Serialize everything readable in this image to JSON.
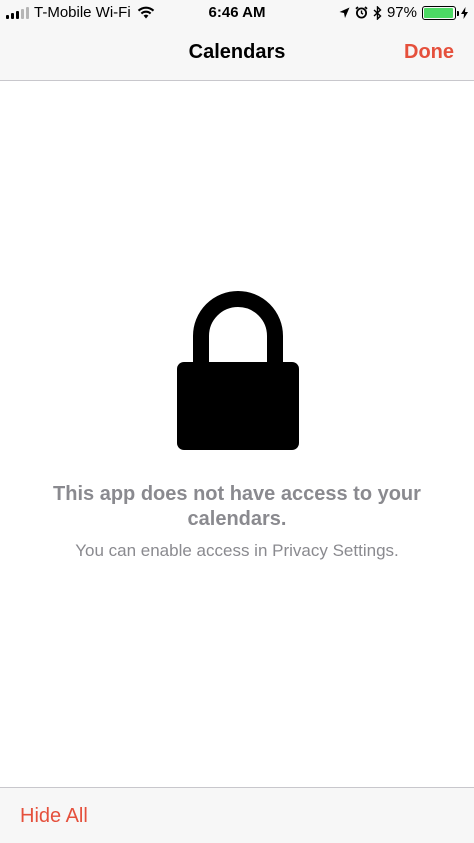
{
  "status_bar": {
    "carrier": "T-Mobile Wi-Fi",
    "time": "6:46 AM",
    "battery_percent": "97%",
    "battery_level": 0.97,
    "icons": [
      "signal-bars-icon",
      "wifi-icon",
      "location-arrow-icon",
      "alarm-clock-icon",
      "bluetooth-icon",
      "battery-icon",
      "charging-bolt-icon"
    ]
  },
  "nav": {
    "title": "Calendars",
    "done_label": "Done"
  },
  "content": {
    "icon": "lock-icon",
    "message_title": "This app does not have access to your calendars.",
    "message_subtitle": "You can enable access in Privacy Settings."
  },
  "toolbar": {
    "hide_all_label": "Hide All"
  },
  "colors": {
    "accent": "#e5503c",
    "bar_background": "#f7f7f7",
    "message_text": "#8a8a8f",
    "battery_green": "#4cd964"
  }
}
